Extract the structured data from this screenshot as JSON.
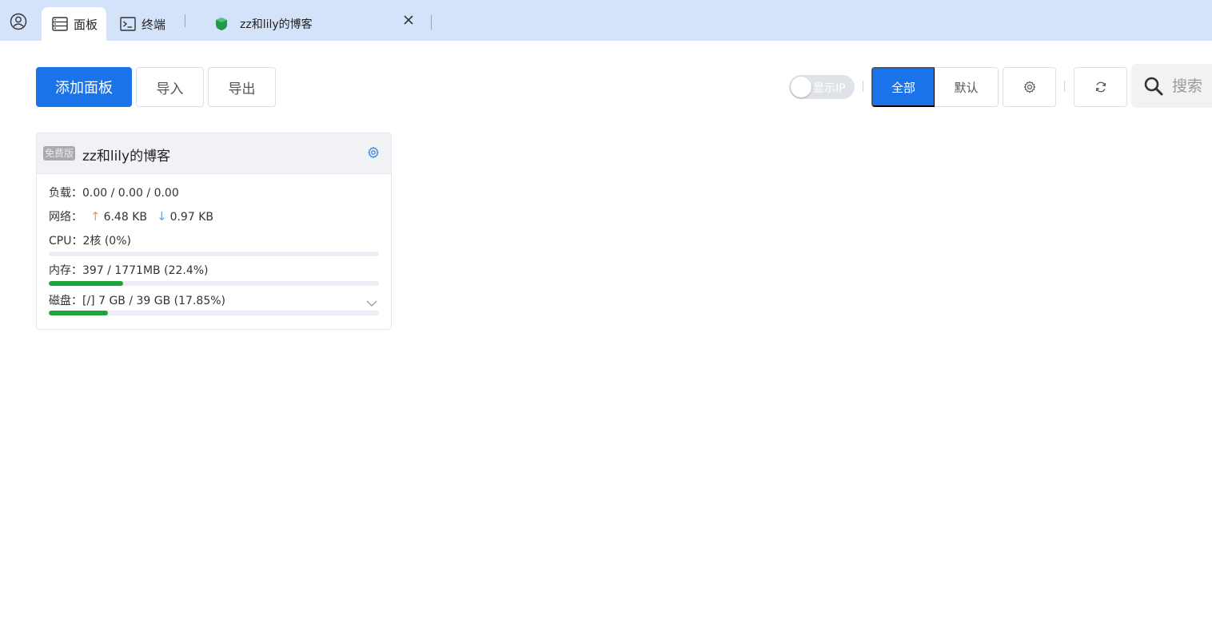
{
  "tabs": {
    "panel": "面板",
    "terminal": "终端",
    "site": "zz和lily的博客"
  },
  "toolbar": {
    "add_label": "添加面板",
    "import_label": "导入",
    "export_label": "导出",
    "show_ip_label": "显示IP",
    "show_ip_on": false,
    "filter_all": "全部",
    "filter_default": "默认",
    "search_placeholder": "搜索"
  },
  "card": {
    "badge": "免费版",
    "title": "zz和lily的博客",
    "load_label": "负载：",
    "load_value": "0.00 / 0.00 / 0.00",
    "net_label": "网络：",
    "net_up": "6.48 KB",
    "net_down": "0.97 KB",
    "cpu_label": "CPU：",
    "cpu_value": "2核 (0%)",
    "cpu_percent": 0,
    "mem_label": "内存：",
    "mem_value": "397 / 1771MB (22.4%)",
    "mem_percent": 22.4,
    "disk_label": "磁盘：",
    "disk_value": "[/] 7 GB / 39 GB (17.85%)",
    "disk_percent": 17.85
  },
  "colors": {
    "accent": "#1a73e8",
    "progress": "#1fa33d",
    "tabbar": "#d5e3fa"
  },
  "icons": [
    "account-icon",
    "panel-icon",
    "terminal-icon",
    "shield-icon",
    "close-icon",
    "gear-icon",
    "refresh-icon",
    "search-icon",
    "chevron-down-icon"
  ]
}
